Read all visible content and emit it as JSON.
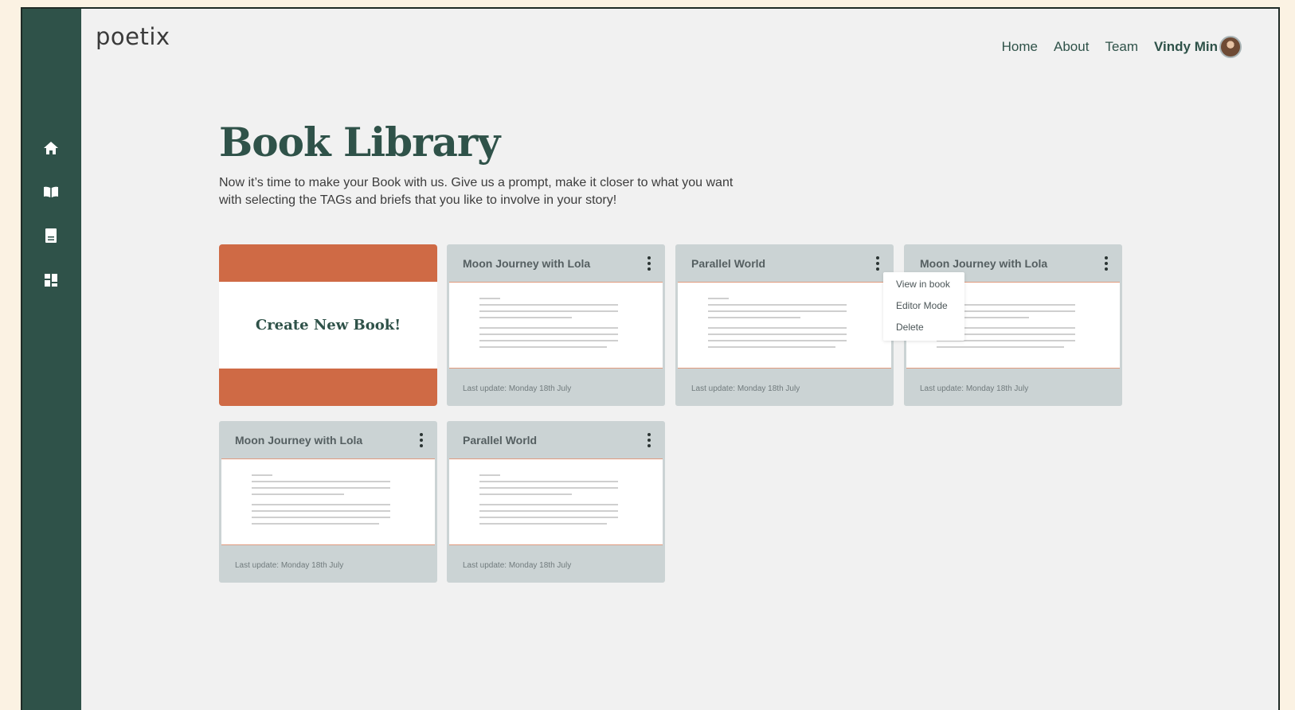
{
  "app": {
    "logo": "poetix"
  },
  "nav": {
    "home": "Home",
    "about": "About",
    "team": "Team",
    "user_name": "Vindy Min"
  },
  "sidebar": {
    "icons": [
      "home-icon",
      "open-book-icon",
      "book-icon",
      "dashboard-icon"
    ]
  },
  "main": {
    "title": "Book Library",
    "description": "Now it’s time to make your Book with us. Give us a prompt, make it closer to what you want with selecting the TAGs and briefs that you like to involve in your story!"
  },
  "create_card": {
    "label": "Create New Book!"
  },
  "books": [
    {
      "title": "Moon Journey with Lola",
      "updated": "Last update: Monday 18th July"
    },
    {
      "title": "Parallel World",
      "updated": "Last update: Monday 18th July"
    },
    {
      "title": "Moon Journey with Lola",
      "updated": "Last update: Monday 18th July"
    },
    {
      "title": "Moon Journey with Lola",
      "updated": "Last update: Monday 18th July"
    },
    {
      "title": "Parallel World",
      "updated": "Last update: Monday 18th July"
    }
  ],
  "context_menu": {
    "items": [
      "View in book",
      "Editor Mode",
      "Delete"
    ]
  },
  "colors": {
    "accent": "#2f5249",
    "create_card": "#cf6a45",
    "card_bg": "#cbd3d4",
    "page_bg": "#f1f1f1"
  }
}
